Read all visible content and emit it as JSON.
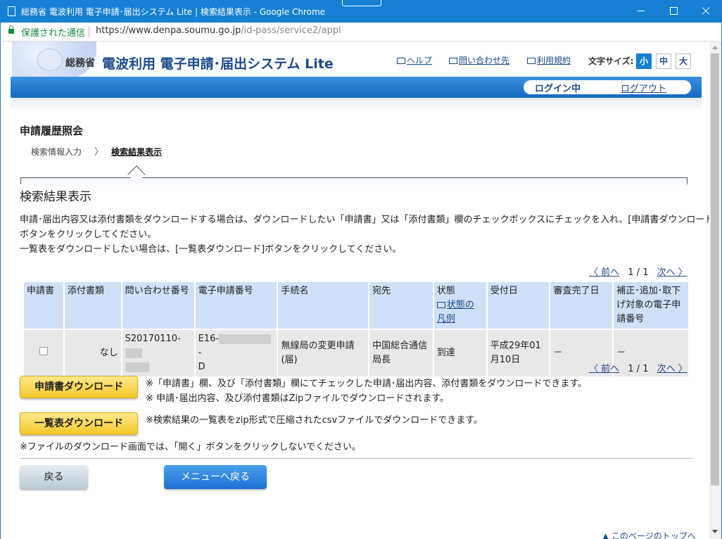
{
  "browser": {
    "window_title": "総務省 電波利用 電子申請･届出システム Lite | 検索結果表示 - Google Chrome",
    "secure_label": "保護された通信",
    "url_host": "https://www.denpa.soumu.go.jp",
    "url_path": "/id-pass/service2/appl"
  },
  "header": {
    "ministry": "総務省",
    "system_title": "電波利用 電子申請･届出システム Lite",
    "links": [
      "ヘルプ",
      "問い合わせ先",
      "利用規約"
    ],
    "font_size_label": "文字サイズ:",
    "font_sizes": [
      "小",
      "中",
      "大"
    ],
    "font_size_active": "小",
    "login_state": "ログイン中",
    "logout": "ログアウト"
  },
  "page": {
    "title": "申請履歴照会",
    "breadcrumb": [
      "検索情報入力",
      "検索結果表示"
    ],
    "breadcrumb_sep": "〉",
    "section_title": "検索結果表示",
    "description": [
      "申請･届出内容又は添付書類をダウンロードする場合は、ダウンロードしたい「申請書」又は「添付書類」欄のチェックボックスにチェックを入れ、[申請書ダウンロード]",
      "ボタンをクリックしてください。",
      "一覧表をダウンロードしたい場合は、[一覧表ダウンロード]ボタンをクリックしてください。"
    ]
  },
  "pager": {
    "prev": "〈 前へ",
    "page": "1 / 1",
    "next": "次へ 〉"
  },
  "table": {
    "headers": [
      "申請書",
      "添付書類",
      "問い合わせ番号",
      "電子申請番号",
      "手続名",
      "宛先",
      "状態",
      "受付日",
      "審査完了日",
      "補正･追加･取下げ対象の電子申請番号"
    ],
    "status_legend_link": "状態の凡例",
    "row": {
      "attachment": "なし",
      "inquiry_no_prefix": "S20170110-",
      "e_app_no_prefix": "E16-",
      "e_app_no_suffix": "D",
      "procedure": "無線局の変更申請(届)",
      "destination": "中国総合通信局長",
      "status": "到達",
      "received_date": "平成29年01月10日",
      "review_done": "－",
      "correction_target": "－"
    }
  },
  "buttons": {
    "app_download": "申請書ダウンロード",
    "list_download": "一覧表ダウンロード",
    "back": "戻る",
    "menu_back": "メニューへ戻る"
  },
  "notes": {
    "app_1": "※「申請書」欄、及び「添付書類」欄にてチェックした申請･届出内容、添付書類をダウンロードできます。",
    "app_2": "※ 申請･届出内容、及び添付書類はZipファイルでダウンロードされます。",
    "list_1": "※検索結果の一覧表をzip形式で圧縮されたcsvファイルでダウンロードできます。",
    "file_warning": "※ファイルのダウンロード画面では、「開く」ボタンをクリックしないでください。"
  },
  "footer": {
    "page_top": "▲ このページのトップへ"
  }
}
